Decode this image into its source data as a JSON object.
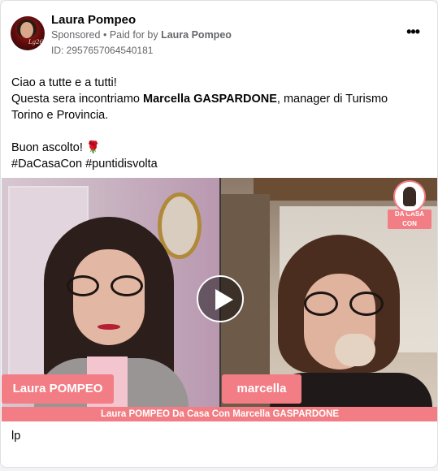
{
  "post": {
    "author_name": "Laura Pompeo",
    "sponsored_label": "Sponsored",
    "separator": "•",
    "paid_for_prefix": "Paid for by",
    "paid_for_name": "Laura Pompeo",
    "ad_id": "ID: 2957657064540181",
    "more_label": "•••",
    "avatar_signature": "Lg26"
  },
  "body": {
    "line1": "Ciao a tutte e a tutti!",
    "line2_prefix": "Questa sera incontriamo ",
    "line2_bold": "Marcella GASPARDONE",
    "line2_suffix": ", manager di Turismo Torino e Provincia.",
    "line3": "Buon ascolto!",
    "rose_emoji": "🌹",
    "hashtags": "#DaCasaCon #puntidisvolta"
  },
  "video": {
    "left_name_tag": "Laura POMPEO",
    "right_name_tag": "marcella",
    "bottom_banner": "Laura POMPEO Da Casa Con Marcella GASPARDONE",
    "brand_label": "DA CASA CON",
    "play_icon": "play-icon",
    "accent_color": "#f37d84"
  },
  "caption": "lp"
}
